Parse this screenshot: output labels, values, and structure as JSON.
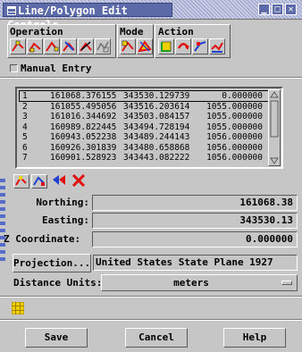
{
  "window": {
    "title": "Line/Polygon Edit Controls",
    "minimize_glyph": "▁",
    "maximize_glyph": "□",
    "close_glyph": "✕"
  },
  "groups": {
    "operation": "Operation",
    "mode": "Mode",
    "action": "Action"
  },
  "manual_entry": {
    "label": "Manual Entry",
    "checked": false
  },
  "vertex_list": {
    "rows": [
      {
        "index": "1",
        "x": "161068.376155",
        "y": "343530.129739",
        "z": "0.000000",
        "selected": true
      },
      {
        "index": "2",
        "x": "161055.495056",
        "y": "343516.203614",
        "z": "1055.000000"
      },
      {
        "index": "3",
        "x": "161016.344692",
        "y": "343503.084157",
        "z": "1055.000000"
      },
      {
        "index": "4",
        "x": "160989.822445",
        "y": "343494.728194",
        "z": "1055.000000"
      },
      {
        "index": "5",
        "x": "160943.052238",
        "y": "343489.244143",
        "z": "1056.000000"
      },
      {
        "index": "6",
        "x": "160926.301839",
        "y": "343480.658868",
        "z": "1056.000000"
      },
      {
        "index": "7",
        "x": "160901.528923",
        "y": "343443.082222",
        "z": "1056.000000"
      }
    ]
  },
  "fields": {
    "northing_label": "Northing:",
    "northing_value": "161068.38",
    "easting_label": "Easting:",
    "easting_value": "343530.13",
    "z_label": "Z Coordinate:",
    "z_value": "0.000000"
  },
  "projection": {
    "button_label": "Projection...",
    "value": "United States State Plane 1927"
  },
  "distance_units": {
    "label": "Distance Units:",
    "value": "meters"
  },
  "buttons": {
    "save": "Save",
    "cancel": "Cancel",
    "help": "Help"
  },
  "colors": {
    "panel": "#c6c6c6",
    "titlebar": "#5c6aa8",
    "icon_red": "#e01010",
    "icon_yellow": "#f0d000",
    "icon_blue": "#2040d0"
  }
}
